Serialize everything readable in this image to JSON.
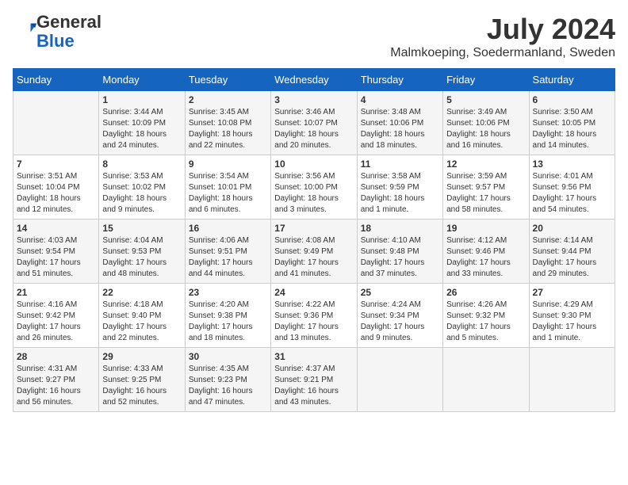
{
  "header": {
    "logo_line1": "General",
    "logo_line2": "Blue",
    "month_year": "July 2024",
    "location": "Malmkoeping, Soedermanland, Sweden"
  },
  "weekdays": [
    "Sunday",
    "Monday",
    "Tuesday",
    "Wednesday",
    "Thursday",
    "Friday",
    "Saturday"
  ],
  "weeks": [
    [
      {
        "day": "",
        "info": ""
      },
      {
        "day": "1",
        "info": "Sunrise: 3:44 AM\nSunset: 10:09 PM\nDaylight: 18 hours\nand 24 minutes."
      },
      {
        "day": "2",
        "info": "Sunrise: 3:45 AM\nSunset: 10:08 PM\nDaylight: 18 hours\nand 22 minutes."
      },
      {
        "day": "3",
        "info": "Sunrise: 3:46 AM\nSunset: 10:07 PM\nDaylight: 18 hours\nand 20 minutes."
      },
      {
        "day": "4",
        "info": "Sunrise: 3:48 AM\nSunset: 10:06 PM\nDaylight: 18 hours\nand 18 minutes."
      },
      {
        "day": "5",
        "info": "Sunrise: 3:49 AM\nSunset: 10:06 PM\nDaylight: 18 hours\nand 16 minutes."
      },
      {
        "day": "6",
        "info": "Sunrise: 3:50 AM\nSunset: 10:05 PM\nDaylight: 18 hours\nand 14 minutes."
      }
    ],
    [
      {
        "day": "7",
        "info": "Sunrise: 3:51 AM\nSunset: 10:04 PM\nDaylight: 18 hours\nand 12 minutes."
      },
      {
        "day": "8",
        "info": "Sunrise: 3:53 AM\nSunset: 10:02 PM\nDaylight: 18 hours\nand 9 minutes."
      },
      {
        "day": "9",
        "info": "Sunrise: 3:54 AM\nSunset: 10:01 PM\nDaylight: 18 hours\nand 6 minutes."
      },
      {
        "day": "10",
        "info": "Sunrise: 3:56 AM\nSunset: 10:00 PM\nDaylight: 18 hours\nand 3 minutes."
      },
      {
        "day": "11",
        "info": "Sunrise: 3:58 AM\nSunset: 9:59 PM\nDaylight: 18 hours\nand 1 minute."
      },
      {
        "day": "12",
        "info": "Sunrise: 3:59 AM\nSunset: 9:57 PM\nDaylight: 17 hours\nand 58 minutes."
      },
      {
        "day": "13",
        "info": "Sunrise: 4:01 AM\nSunset: 9:56 PM\nDaylight: 17 hours\nand 54 minutes."
      }
    ],
    [
      {
        "day": "14",
        "info": "Sunrise: 4:03 AM\nSunset: 9:54 PM\nDaylight: 17 hours\nand 51 minutes."
      },
      {
        "day": "15",
        "info": "Sunrise: 4:04 AM\nSunset: 9:53 PM\nDaylight: 17 hours\nand 48 minutes."
      },
      {
        "day": "16",
        "info": "Sunrise: 4:06 AM\nSunset: 9:51 PM\nDaylight: 17 hours\nand 44 minutes."
      },
      {
        "day": "17",
        "info": "Sunrise: 4:08 AM\nSunset: 9:49 PM\nDaylight: 17 hours\nand 41 minutes."
      },
      {
        "day": "18",
        "info": "Sunrise: 4:10 AM\nSunset: 9:48 PM\nDaylight: 17 hours\nand 37 minutes."
      },
      {
        "day": "19",
        "info": "Sunrise: 4:12 AM\nSunset: 9:46 PM\nDaylight: 17 hours\nand 33 minutes."
      },
      {
        "day": "20",
        "info": "Sunrise: 4:14 AM\nSunset: 9:44 PM\nDaylight: 17 hours\nand 29 minutes."
      }
    ],
    [
      {
        "day": "21",
        "info": "Sunrise: 4:16 AM\nSunset: 9:42 PM\nDaylight: 17 hours\nand 26 minutes."
      },
      {
        "day": "22",
        "info": "Sunrise: 4:18 AM\nSunset: 9:40 PM\nDaylight: 17 hours\nand 22 minutes."
      },
      {
        "day": "23",
        "info": "Sunrise: 4:20 AM\nSunset: 9:38 PM\nDaylight: 17 hours\nand 18 minutes."
      },
      {
        "day": "24",
        "info": "Sunrise: 4:22 AM\nSunset: 9:36 PM\nDaylight: 17 hours\nand 13 minutes."
      },
      {
        "day": "25",
        "info": "Sunrise: 4:24 AM\nSunset: 9:34 PM\nDaylight: 17 hours\nand 9 minutes."
      },
      {
        "day": "26",
        "info": "Sunrise: 4:26 AM\nSunset: 9:32 PM\nDaylight: 17 hours\nand 5 minutes."
      },
      {
        "day": "27",
        "info": "Sunrise: 4:29 AM\nSunset: 9:30 PM\nDaylight: 17 hours\nand 1 minute."
      }
    ],
    [
      {
        "day": "28",
        "info": "Sunrise: 4:31 AM\nSunset: 9:27 PM\nDaylight: 16 hours\nand 56 minutes."
      },
      {
        "day": "29",
        "info": "Sunrise: 4:33 AM\nSunset: 9:25 PM\nDaylight: 16 hours\nand 52 minutes."
      },
      {
        "day": "30",
        "info": "Sunrise: 4:35 AM\nSunset: 9:23 PM\nDaylight: 16 hours\nand 47 minutes."
      },
      {
        "day": "31",
        "info": "Sunrise: 4:37 AM\nSunset: 9:21 PM\nDaylight: 16 hours\nand 43 minutes."
      },
      {
        "day": "",
        "info": ""
      },
      {
        "day": "",
        "info": ""
      },
      {
        "day": "",
        "info": ""
      }
    ]
  ]
}
